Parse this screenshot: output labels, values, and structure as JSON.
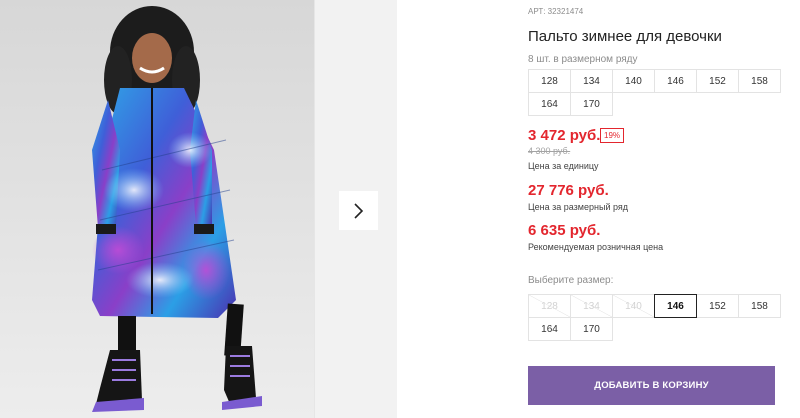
{
  "product": {
    "article": "АРТ: 32321474",
    "title": "Пальто зимнее для девочки",
    "pack_note": "8 шт. в размерном ряду"
  },
  "size_row": [
    "128",
    "134",
    "140",
    "146",
    "152",
    "158",
    "164",
    "170"
  ],
  "pricing": {
    "unit_price": "3 472 руб.",
    "discount": "19%",
    "old_price": "4 300 руб.",
    "unit_caption": "Цена за единицу",
    "pack_price": "27 776 руб.",
    "pack_caption": "Цена за размерный ряд",
    "rrp_price": "6 635 руб.",
    "rrp_caption": "Рекомендуемая розничная цена"
  },
  "size_picker": {
    "label": "Выберите размер:",
    "options": [
      {
        "label": "128",
        "available": false
      },
      {
        "label": "134",
        "available": false
      },
      {
        "label": "140",
        "available": false
      },
      {
        "label": "146",
        "available": true,
        "selected": true
      },
      {
        "label": "152",
        "available": true
      },
      {
        "label": "158",
        "available": true
      },
      {
        "label": "164",
        "available": true
      },
      {
        "label": "170",
        "available": true
      }
    ]
  },
  "cart_button": "ДОБАВИТЬ В КОРЗИНУ",
  "colors": {
    "accent_price": "#e3262e",
    "cart_button": "#7b5fa6"
  },
  "icons": {
    "next": "chevron-right-icon"
  }
}
